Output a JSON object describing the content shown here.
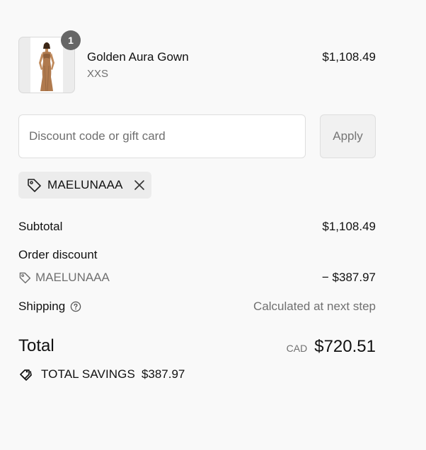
{
  "product": {
    "name": "Golden Aura Gown",
    "variant": "XXS",
    "price": "$1,108.49",
    "quantity": "1",
    "image_alt_icon": "gown-photo"
  },
  "discount": {
    "placeholder": "Discount code or gift card",
    "value": "",
    "apply_label": "Apply",
    "applied_code": "MAELUNAAA"
  },
  "summary": {
    "subtotal_label": "Subtotal",
    "subtotal_value": "$1,108.49",
    "order_discount_label": "Order discount",
    "discount_code": "MAELUNAAA",
    "discount_value": "− $387.97",
    "shipping_label": "Shipping",
    "shipping_value": "Calculated at next step",
    "total_label": "Total",
    "currency": "CAD",
    "total_value": "$720.51",
    "savings_label": "TOTAL SAVINGS",
    "savings_value": "$387.97"
  },
  "icons": {
    "tag": "tag-icon",
    "close": "close-icon",
    "help": "help-circle-icon",
    "savings": "double-tag-icon"
  },
  "colors": {
    "background": "#f9f9f9",
    "badge": "#666666",
    "muted_text": "#707070"
  }
}
